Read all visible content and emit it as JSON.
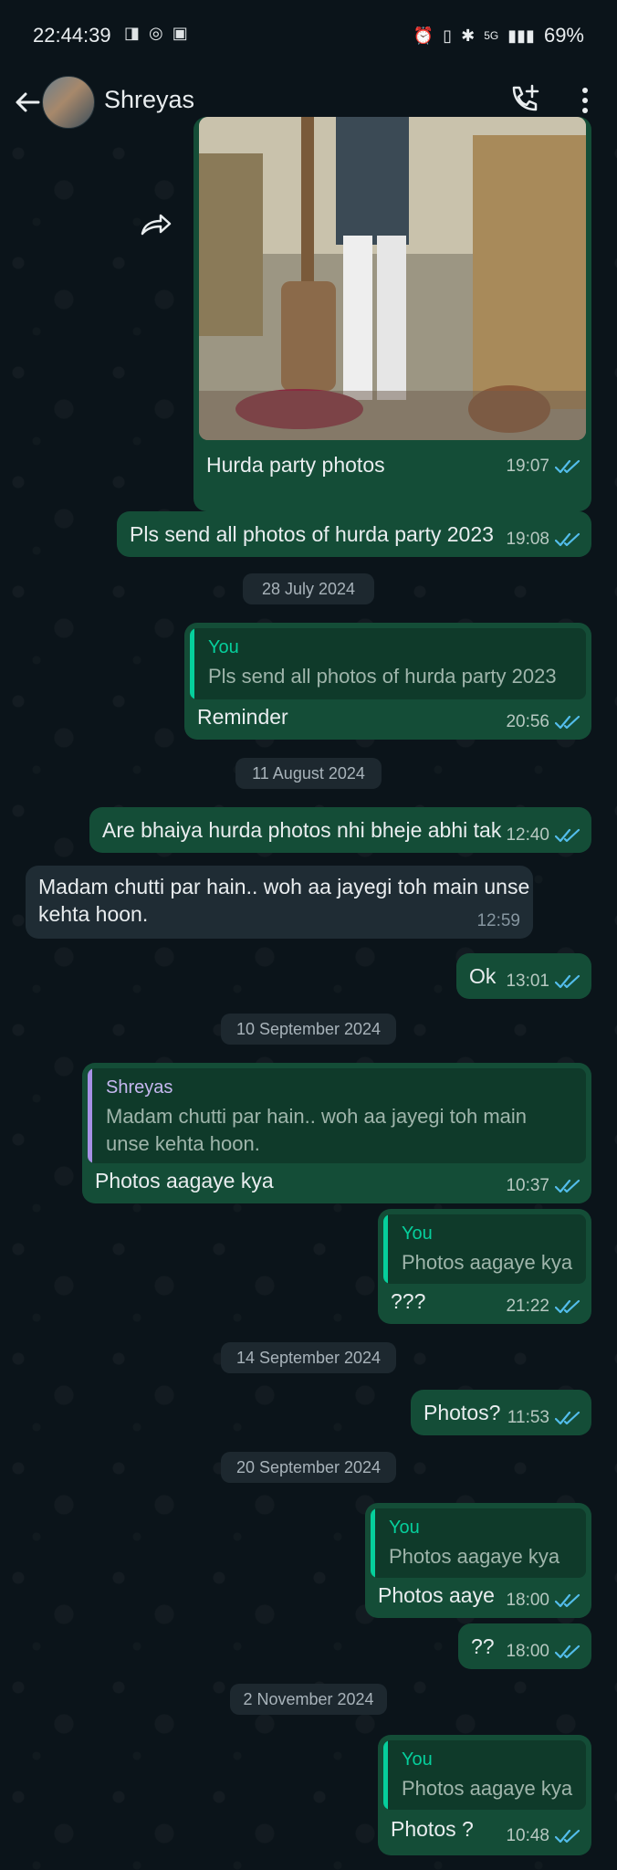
{
  "status_bar": {
    "time": "22:44:39",
    "battery": "69%",
    "signal": "5G"
  },
  "header": {
    "contact_name": "Shreyas"
  },
  "messages": [
    {
      "caption": "Hurda party photos",
      "time": "19:07"
    },
    {
      "text": "Pls send all photos of hurda party 2023",
      "time": "19:08"
    },
    {
      "date": "28 July 2024"
    },
    {
      "quote_author": "You",
      "quote_text": "Pls send all photos of hurda party 2023",
      "text": "Reminder",
      "time": "20:56"
    },
    {
      "date": "11 August 2024"
    },
    {
      "text": "Are bhaiya hurda photos nhi bheje abhi tak",
      "time": "12:40"
    },
    {
      "text_line1": "Madam chutti par hain.. woh aa jayegi toh main unse",
      "text_line2": "kehta hoon.",
      "time": "12:59"
    },
    {
      "text": "Ok",
      "time": "13:01"
    },
    {
      "date": "10 September 2024"
    },
    {
      "quote_author": "Shreyas",
      "quote_line1": "Madam chutti par hain.. woh aa jayegi toh main",
      "quote_line2": "unse kehta hoon.",
      "text": "Photos aagaye kya",
      "time": "10:37"
    },
    {
      "quote_author": "You",
      "quote_text": "Photos aagaye kya",
      "text": "???",
      "time": "21:22"
    },
    {
      "date": "14 September 2024"
    },
    {
      "text": "Photos?",
      "time": "11:53"
    },
    {
      "date": "20 September 2024"
    },
    {
      "quote_author": "You",
      "quote_text": "Photos aagaye kya",
      "text": "Photos aaye",
      "time": "18:00"
    },
    {
      "text": "??",
      "time": "18:00"
    },
    {
      "date": "2 November 2024"
    },
    {
      "quote_author": "You",
      "quote_text": "Photos aagaye kya",
      "text": "Photos ?",
      "time": "10:48"
    }
  ],
  "colors": {
    "background": "#0b141a",
    "outgoing_bubble": "#144d37",
    "incoming_bubble": "#1f2c34",
    "read_ticks": "#53bdeb",
    "quote_bar_you": "#06cf9c",
    "quote_bar_contact": "#a791e6"
  },
  "icons": [
    "back-arrow-icon",
    "add-call-icon",
    "more-options-icon",
    "forward-icon",
    "double-check-icon"
  ]
}
